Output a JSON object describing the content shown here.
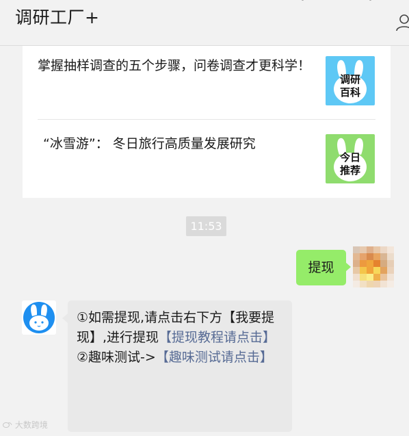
{
  "header": {
    "title": "调研工厂+"
  },
  "articles": [
    {
      "title": "掌握抽样调查的五个步骤，问卷调查才更科学！",
      "thumb_text_line1": "调研",
      "thumb_text_line2": "百科",
      "thumb_color": "#5ec8f5"
    },
    {
      "title": "“冰雪游”： 冬日旅行高质量发展研究",
      "thumb_text_line1": "今日",
      "thumb_text_line2": "推荐",
      "thumb_color": "#8fdc6e"
    }
  ],
  "chat": {
    "timestamp": "11:53",
    "sent_message": "提现",
    "received": {
      "line1_prefix": "①如需提现,请点击右下方【我要提现】,进行提现",
      "line1_link": "【提现教程请点击】",
      "line2_prefix": "②趣味测试->",
      "line2_link": "【趣味测试请点击】"
    }
  },
  "watermark": "大数跨境",
  "colors": {
    "sent_bubble": "#95ec69",
    "received_bubble": "#e9e9e9",
    "link": "#576b95",
    "brand_blue": "#1e8ff0"
  },
  "icons": {
    "header_right": "user-icon",
    "bot_avatar": "rabbit-logo-icon"
  }
}
